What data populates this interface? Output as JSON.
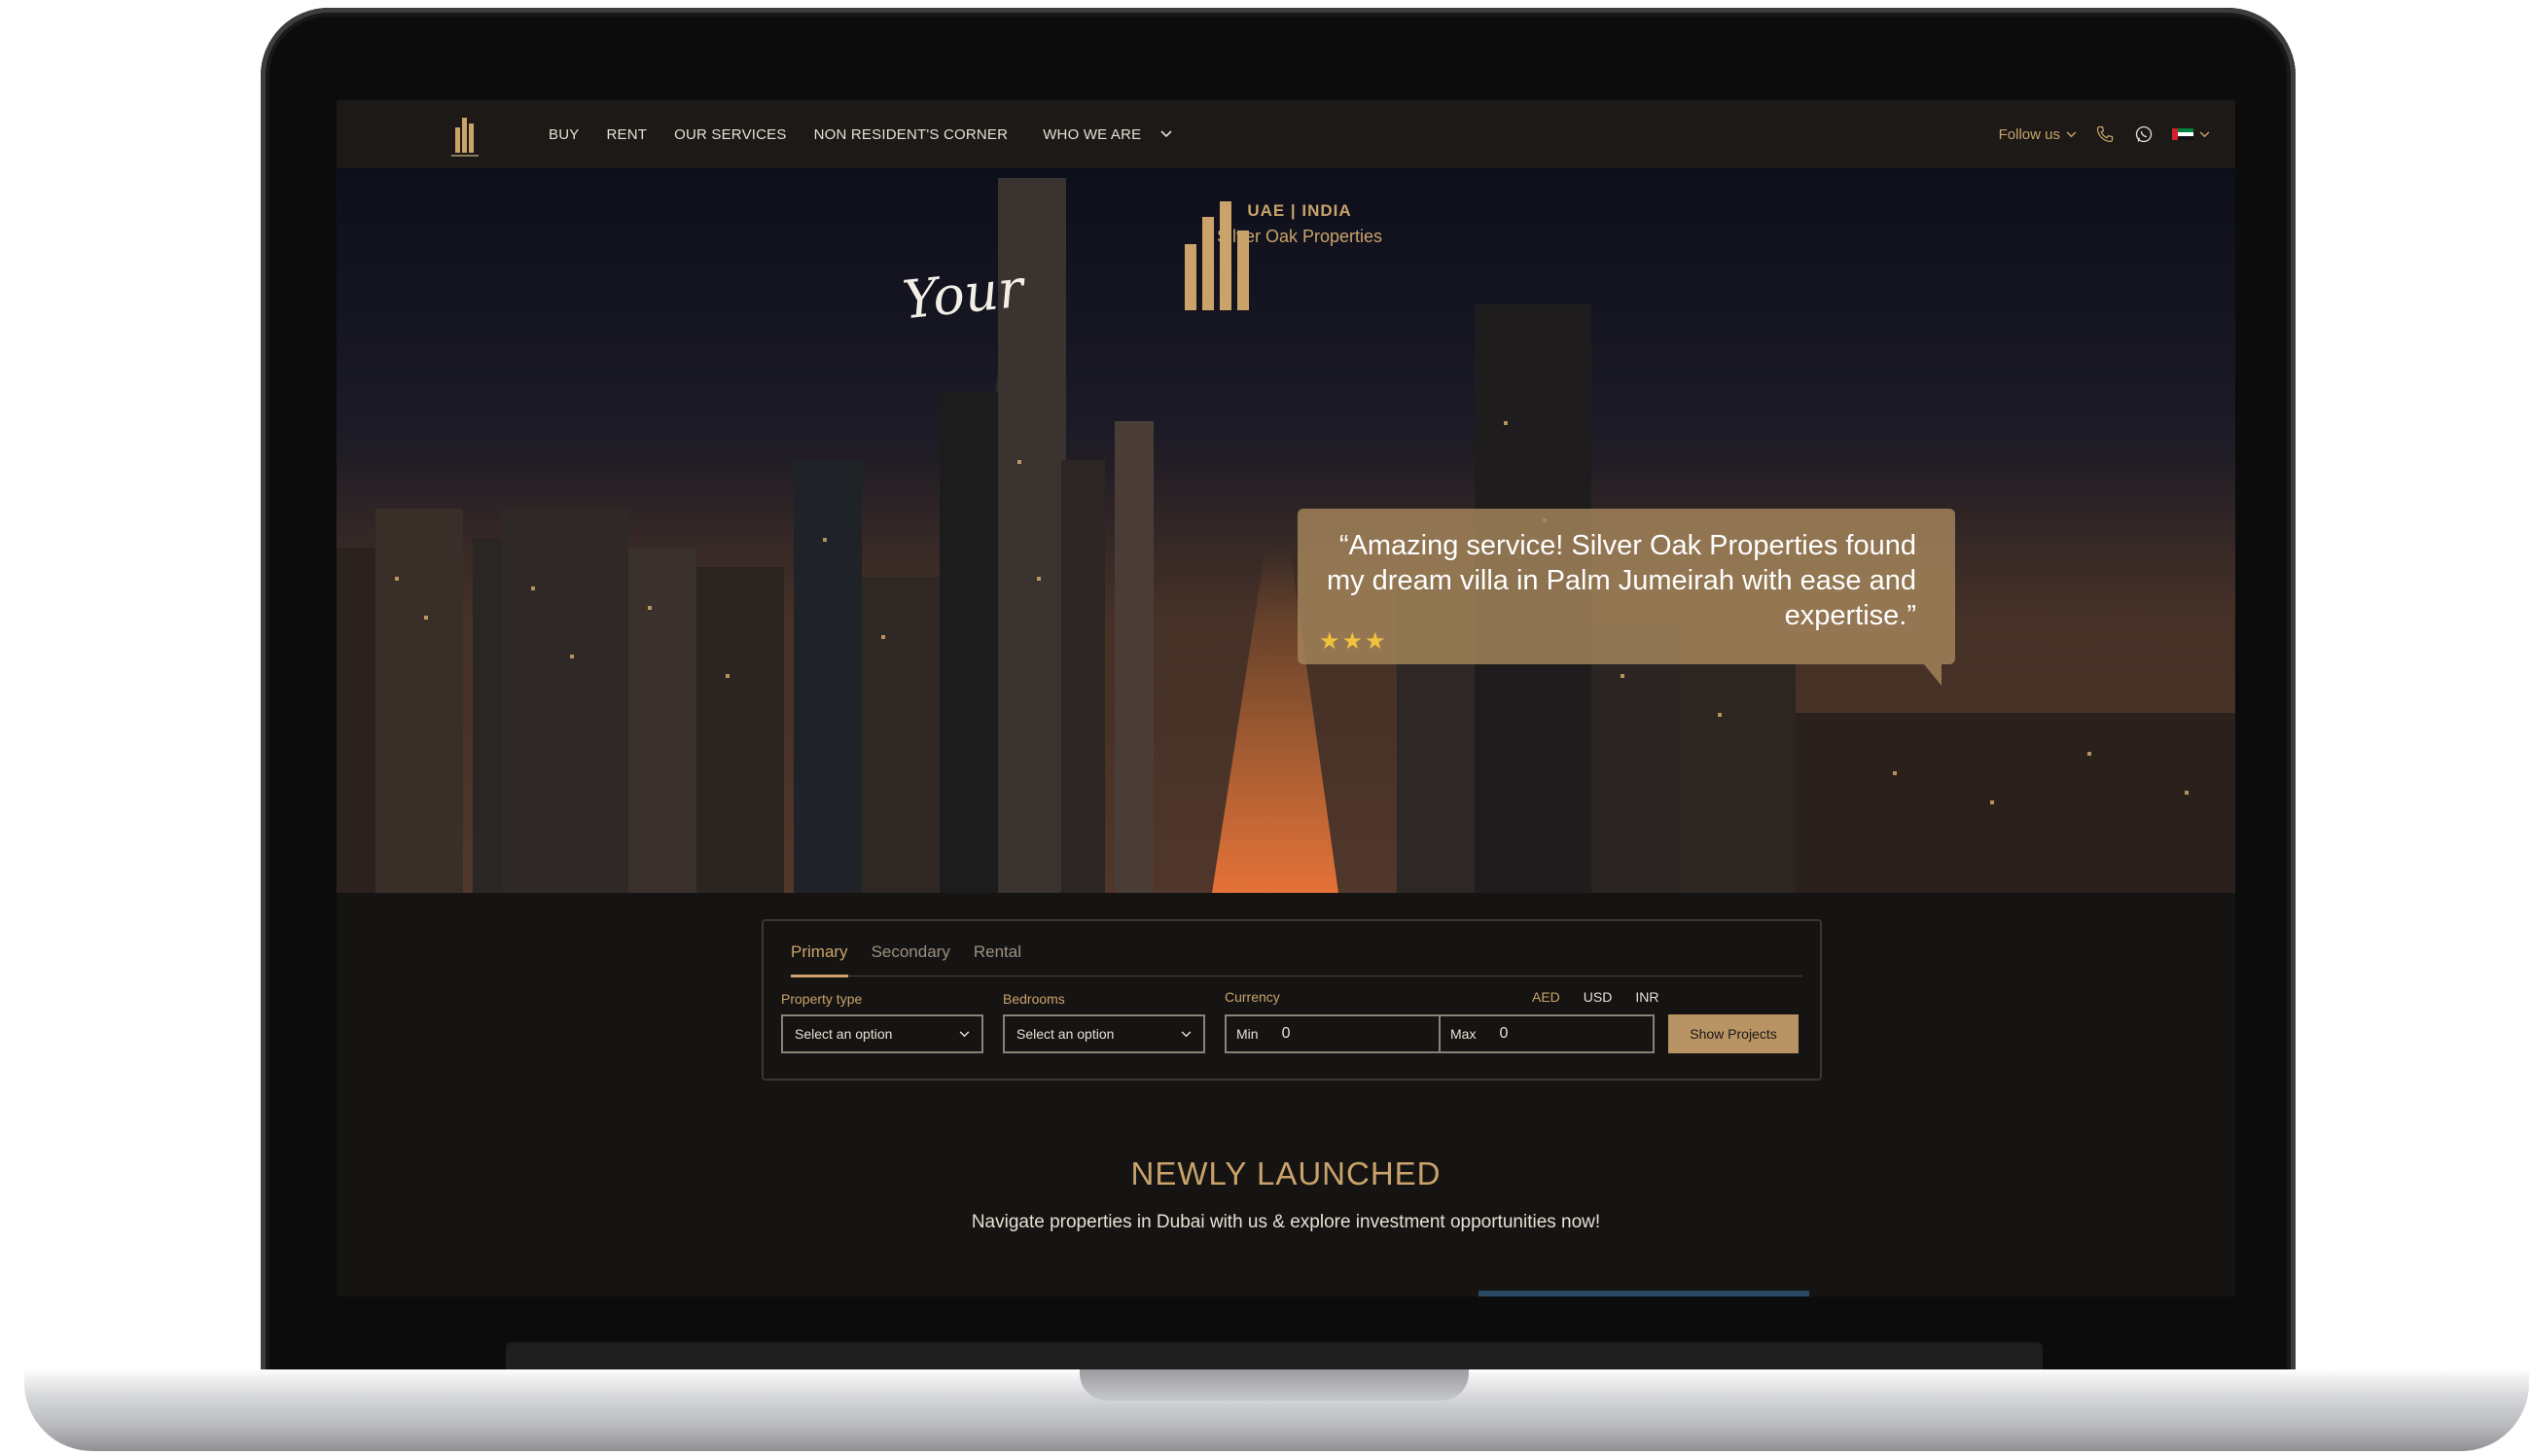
{
  "nav": {
    "logo_alt": "SOP",
    "items": [
      {
        "label": "BUY"
      },
      {
        "label": "RENT"
      },
      {
        "label": "OUR SERVICES"
      },
      {
        "label": "NON RESIDENT'S CORNER"
      },
      {
        "label": "WHO WE ARE"
      }
    ],
    "follow_label": "Follow us",
    "icons": [
      "phone-icon",
      "whatsapp-icon",
      "uae-flag-icon"
    ]
  },
  "hero": {
    "script_text": "Your",
    "logo_line1": "UAE | INDIA",
    "logo_line2": "Silver Oak Properties",
    "quote": "“Amazing service! Silver Oak Properties found my dream villa in Palm Jumeirah with ease and expertise.”",
    "stars": "★★★",
    "rating": 3
  },
  "search": {
    "tabs": [
      "Primary",
      "Secondary",
      "Rental"
    ],
    "active_tab": "Primary",
    "property_type_label": "Property type",
    "property_type_value": "Select an option",
    "bedrooms_label": "Bedrooms",
    "bedrooms_value": "Select an option",
    "currency_label": "Currency",
    "currencies": [
      "AED",
      "USD",
      "INR"
    ],
    "min_label": "Min",
    "min_value": "0",
    "max_label": "Max",
    "max_value": "0",
    "submit_label": "Show Projects"
  },
  "section": {
    "title": "NEWLY LAUNCHED",
    "subtitle": "Navigate properties in Dubai with us & explore investment opportunities now!"
  },
  "colors": {
    "gold": "#c9a36a",
    "background": "#161413",
    "nav_text": "#e7e0d4"
  }
}
